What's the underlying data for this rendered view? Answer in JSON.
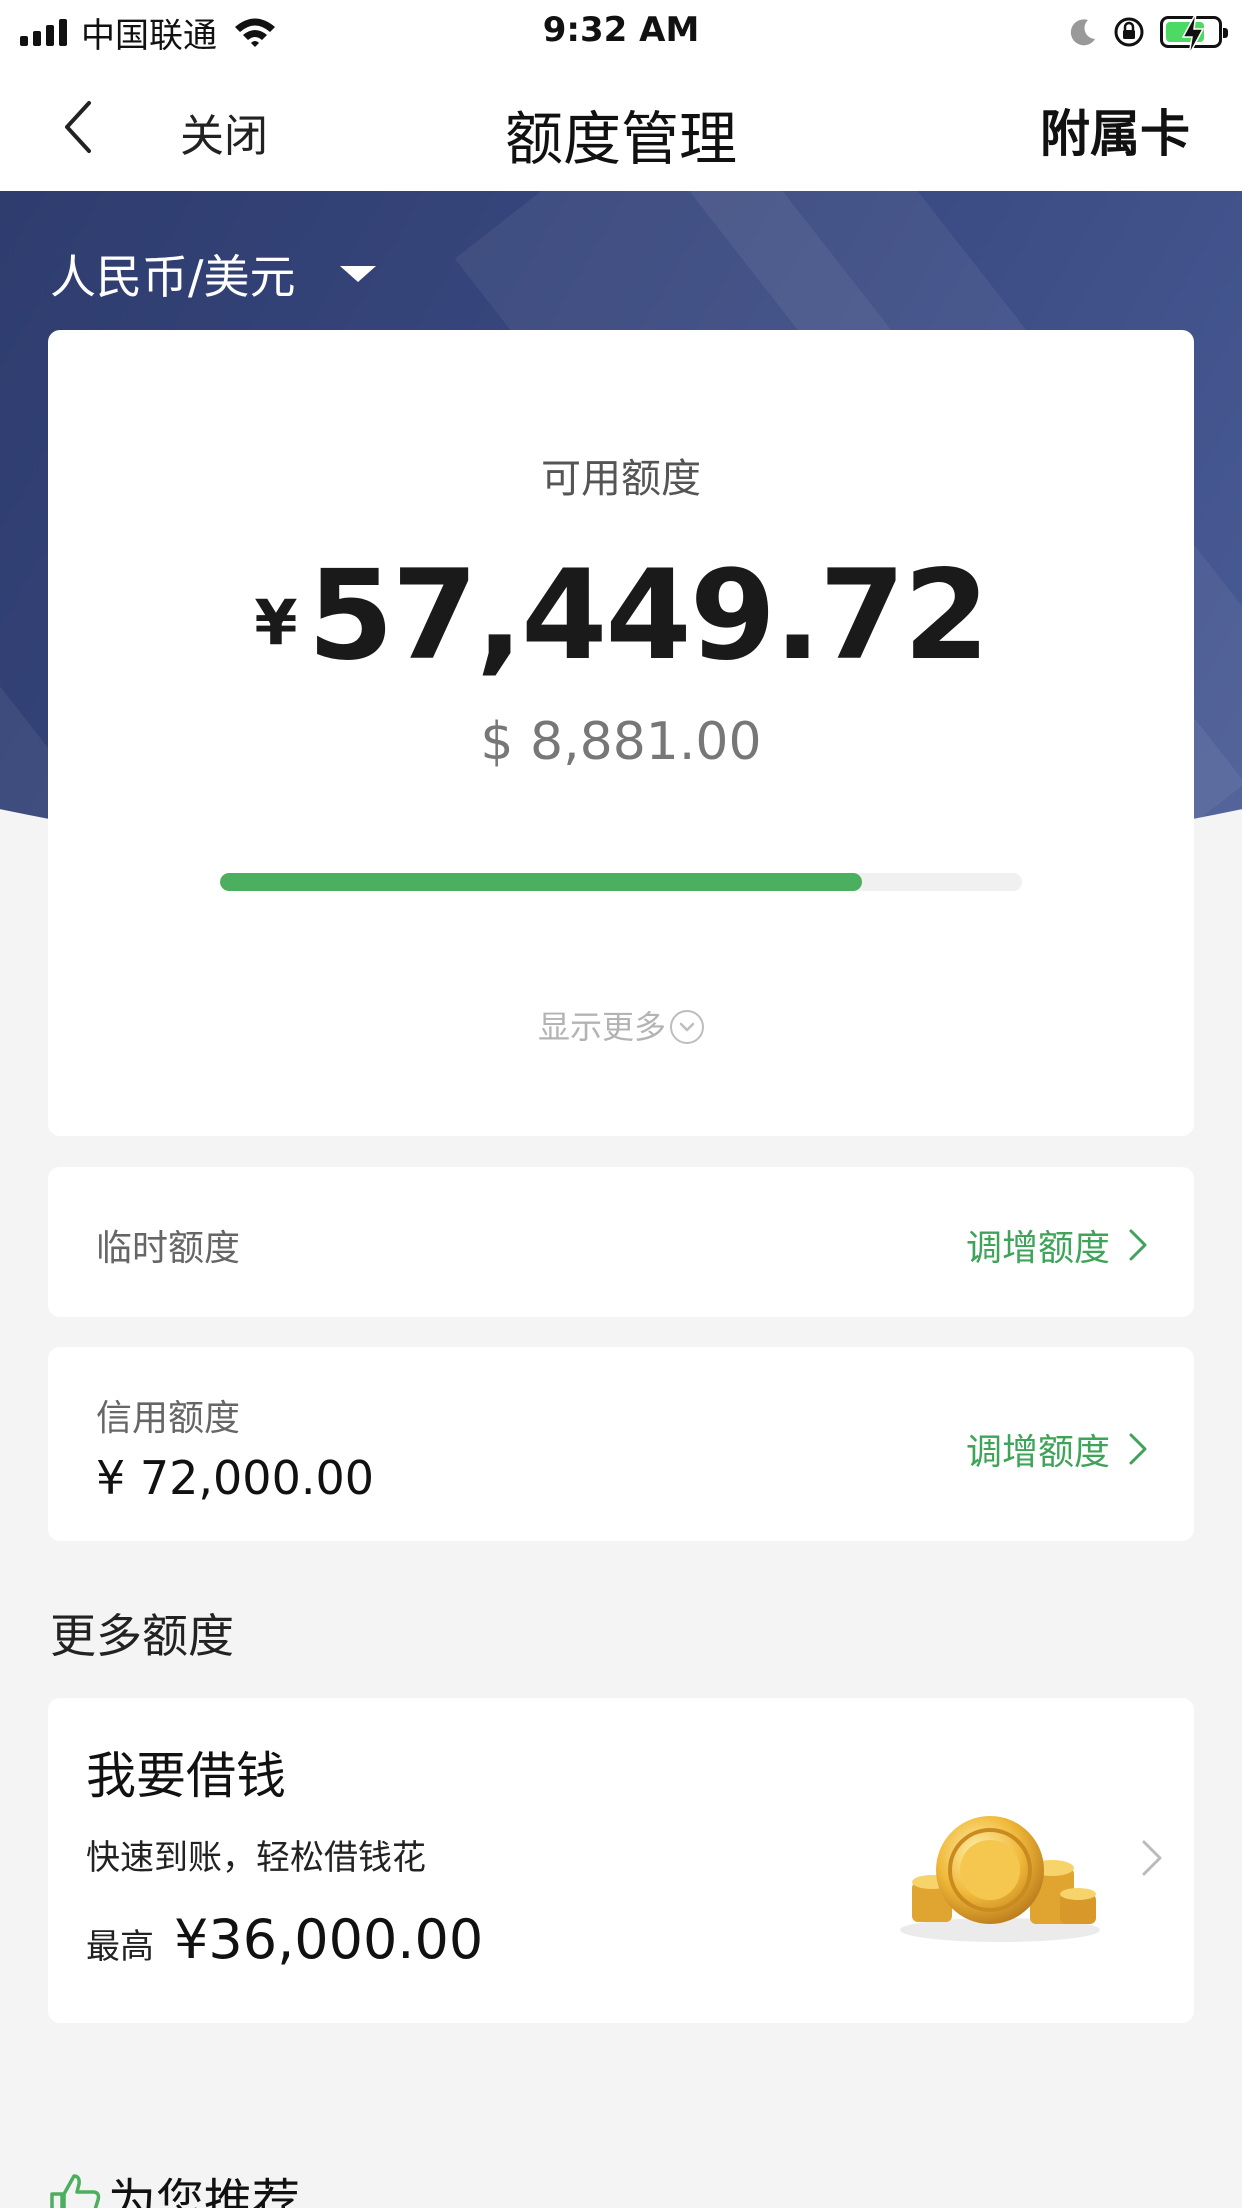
{
  "status_bar": {
    "carrier": "中国联通",
    "time": "9:32 AM",
    "battery_level": 0.75,
    "icons": [
      "signal-icon",
      "wifi-icon",
      "moon-icon",
      "orientation-lock-icon",
      "battery-charging-icon"
    ]
  },
  "nav": {
    "back_icon": "chevron-left-icon",
    "close_label": "关闭",
    "title": "额度管理",
    "right_label": "附属卡"
  },
  "currency_selector": {
    "label": "人民币/美元",
    "icon": "caret-down-icon"
  },
  "main_card": {
    "available_label": "可用额度",
    "currency_symbol": "¥",
    "available_amount": "57,449.72",
    "usd_amount": "$ 8,881.00",
    "usage_fraction": 0.8,
    "show_more_label": "显示更多",
    "show_more_icon": "chevron-down-circle-icon"
  },
  "temporary_limit": {
    "label": "临时额度",
    "action": "调增额度"
  },
  "credit_limit": {
    "label": "信用额度",
    "value": "¥ 72,000.00",
    "action": "调增额度"
  },
  "more_section": {
    "title": "更多额度"
  },
  "loan_card": {
    "title": "我要借钱",
    "subtitle": "快速到账，轻松借钱花",
    "max_prefix": "最高",
    "max_value": "¥36,000.00",
    "image_icon": "gold-coins-icon"
  },
  "recommend": {
    "label": "为您推荐",
    "icon": "thumbs-up-icon"
  },
  "colors": {
    "accent_green": "#3fa45a",
    "progress_green": "#4cae5f",
    "hero_blue": "#2e3c6e",
    "background": "#f4f4f4"
  }
}
